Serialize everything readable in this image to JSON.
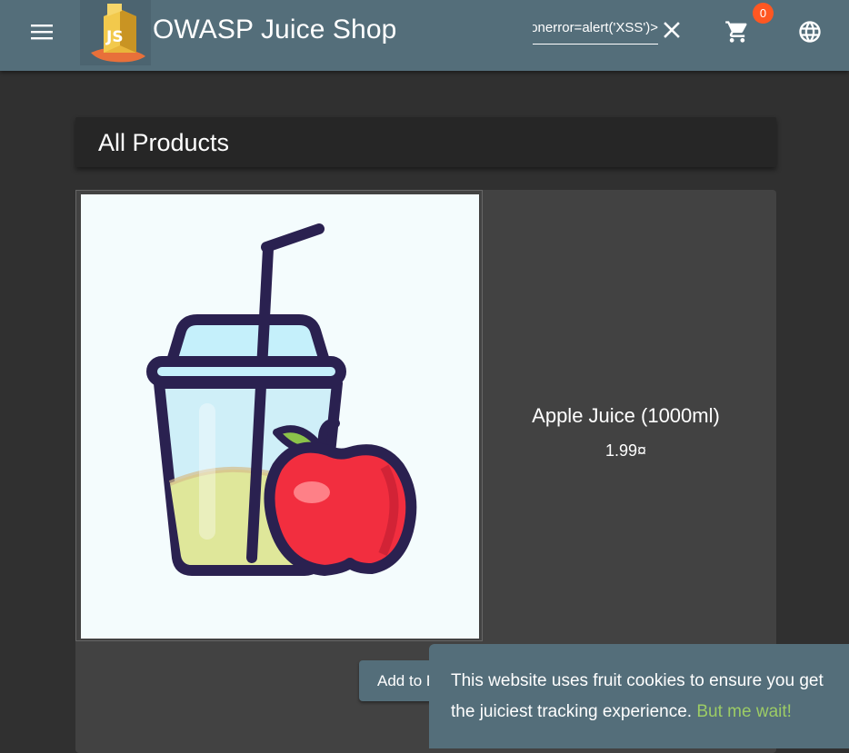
{
  "header": {
    "menu_icon": "hamburger-menu-icon",
    "logo_icon": "juice-carton-logo",
    "title": "OWASP Juice Shop",
    "search": {
      "value": "<img src=x onerror=alert('XSS')>"
    },
    "clear_icon": "close-icon",
    "cart_icon": "shopping-cart-icon",
    "cart_count": "0",
    "language_icon": "globe-icon"
  },
  "main": {
    "heading": "All Products",
    "products": [
      {
        "name": "Apple Juice (1000ml)",
        "price": "1.99¤",
        "image_icon": "apple-juice-cup-illustration",
        "add_button_label": "Add to Basket"
      }
    ]
  },
  "cookie_banner": {
    "message": "This website uses fruit cookies to ensure you get the juiciest tracking experience.",
    "link": "But me wait!"
  },
  "colors": {
    "toolbar": "#546e7a",
    "background": "#303030",
    "card": "#424242",
    "badge": "#ff5722",
    "link": "#9ccc65"
  }
}
